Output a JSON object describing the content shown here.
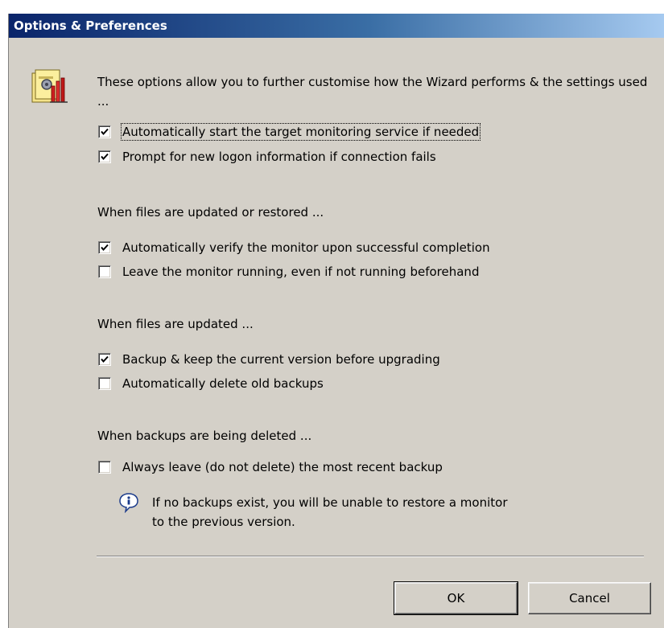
{
  "window": {
    "title": "Options & Preferences"
  },
  "intro": "These options allow you to further customise how the Wizard performs & the settings used ...",
  "general_options": [
    {
      "label": "Automatically start the target monitoring service if needed",
      "checked": true
    },
    {
      "label": "Prompt for new logon information if connection fails",
      "checked": true
    }
  ],
  "section_updated_restored": {
    "heading": "When files are updated or restored ...",
    "options": [
      {
        "label": "Automatically verify the monitor upon successful completion",
        "checked": true
      },
      {
        "label": "Leave the monitor running, even if not running beforehand",
        "checked": false
      }
    ]
  },
  "section_updated": {
    "heading": "When files are updated ...",
    "options": [
      {
        "label": "Backup & keep the current version before upgrading",
        "checked": true
      },
      {
        "label": "Automatically delete old backups",
        "checked": false
      }
    ]
  },
  "section_deleted": {
    "heading": "When backups are being deleted ...",
    "options": [
      {
        "label": "Always leave (do not delete) the most recent backup",
        "checked": false
      }
    ]
  },
  "info": {
    "icon": "info-balloon-icon",
    "line1": "If no backups exist, you will be unable to restore a monitor",
    "line2": "to the previous version."
  },
  "buttons": {
    "ok": "OK",
    "cancel": "Cancel"
  },
  "colors": {
    "dialog_bg": "#d4d0c8",
    "title_start": "#0a246a",
    "title_end": "#a6caf0"
  }
}
